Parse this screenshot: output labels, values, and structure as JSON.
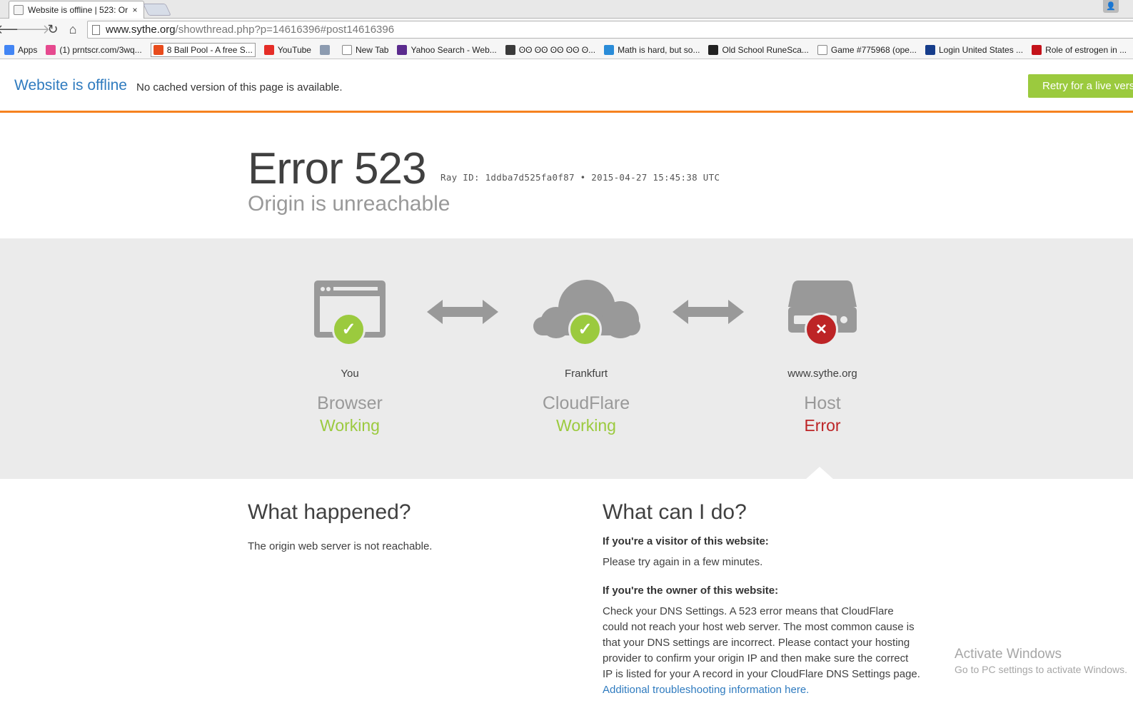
{
  "browser": {
    "tab_title": "Website is offline | 523: Or",
    "tab_close": "×",
    "url_host": "www.sythe.org",
    "url_path": "/showthread.php?p=14616396#post14616396",
    "back": "🡐",
    "forward": "🡒",
    "reload": "↻",
    "home": "⌂",
    "profile_icon": "👤"
  },
  "bookmarks": [
    {
      "label": "Apps",
      "icon_color": "#4285f4"
    },
    {
      "label": "(1) prntscr.com/3wq...",
      "icon_color": "#e64a8f"
    },
    {
      "label": "8 Ball Pool - A free S...",
      "icon_color": "#e84b1c",
      "active": true
    },
    {
      "label": "YouTube",
      "icon_color": "#e52d27"
    },
    {
      "label": "",
      "icon_color": "#8c9bb0"
    },
    {
      "label": "New Tab",
      "icon_color": "#ffffff"
    },
    {
      "label": "Yahoo Search - Web...",
      "icon_color": "#5b2b8e"
    },
    {
      "label": "ʘʘ ʘʘ ʘʘ ʘʘ ʘ...",
      "icon_color": "#3a3a3a"
    },
    {
      "label": "Math is hard, but so...",
      "icon_color": "#2a8cd8"
    },
    {
      "label": "Old School RuneSca...",
      "icon_color": "#222222"
    },
    {
      "label": "Game #775968 (ope...",
      "icon_color": "#ffffff"
    },
    {
      "label": "Login United States ...",
      "icon_color": "#163d8b"
    },
    {
      "label": "Role of estrogen in ...",
      "icon_color": "#c4121a"
    }
  ],
  "offline": {
    "title": "Website is offline",
    "message": "No cached version of this page is available.",
    "retry": "Retry for a live version"
  },
  "error": {
    "code": "Error 523",
    "ray": "Ray ID: 1ddba7d525fa0f87 • 2015-04-27 15:45:38 UTC",
    "subtitle": "Origin is unreachable"
  },
  "nodes": [
    {
      "location": "You",
      "name": "Browser",
      "status": "Working",
      "ok": true,
      "badge": "✓"
    },
    {
      "location": "Frankfurt",
      "name": "CloudFlare",
      "status": "Working",
      "ok": true,
      "badge": "✓"
    },
    {
      "location": "www.sythe.org",
      "name": "Host",
      "status": "Error",
      "ok": false,
      "badge": "✕"
    }
  ],
  "what_happened": {
    "title": "What happened?",
    "text": "The origin web server is not reachable."
  },
  "what_can_i_do": {
    "title": "What can I do?",
    "visitor_heading": "If you're a visitor of this website:",
    "visitor_text": "Please try again in a few minutes.",
    "owner_heading": "If you're the owner of this website:",
    "owner_text": "Check your DNS Settings. A 523 error means that CloudFlare could not reach your host web server. The most common cause is that your DNS settings are incorrect. Please contact your hosting provider to confirm your origin IP and then make sure the correct IP is listed for your A record in your CloudFlare DNS Settings page.",
    "owner_link": "Additional troubleshooting information here."
  },
  "watermark": {
    "line1": "Activate Windows",
    "line2": "Go to PC settings to activate Windows."
  },
  "colors": {
    "accent_orange": "#f6821f",
    "ok_green": "#9bca3e",
    "error_red": "#bd2426",
    "link_blue": "#2f7bbf"
  }
}
